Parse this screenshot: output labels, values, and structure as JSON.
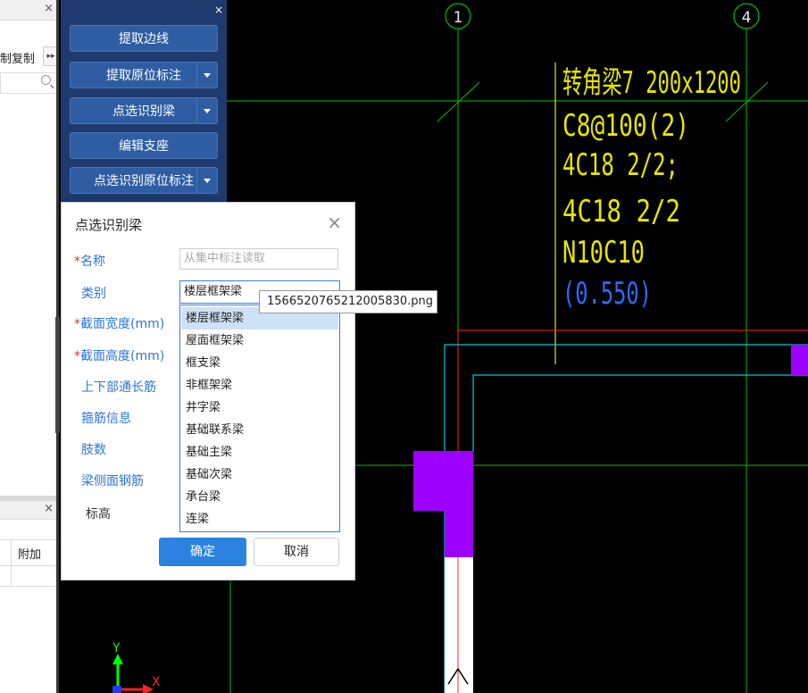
{
  "left_panel": {
    "copy_label": "制复制",
    "copy_more_icon": "double-chevron-right-icon",
    "search_icon": "search-icon",
    "close_icon": "close-icon",
    "grid_header": "附加"
  },
  "toolbar": {
    "close": "×",
    "buttons": [
      {
        "label": "提取边线",
        "has_menu": false
      },
      {
        "label": "提取原位标注",
        "has_menu": true
      },
      {
        "label": "点选识别梁",
        "has_menu": true
      },
      {
        "label": "编辑支座",
        "has_menu": false
      },
      {
        "label": "点选识别原位标注",
        "has_menu": true
      }
    ]
  },
  "cad": {
    "axis_left": "1",
    "axis_right": "4",
    "annotation": {
      "line1": "转角梁7 200x1200",
      "line2": "C8@100(2)",
      "line3": "4C18 2/2;",
      "line4": "4C18 2/2",
      "line5": "N10C10",
      "line6": "(0.550)"
    },
    "ucs_y": "Y",
    "ucs_x": "X",
    "colors": {
      "yellow": "#e6e600",
      "green": "#00c000",
      "red": "#ff2020",
      "cyan": "#00c8d8",
      "magenta": "#9d00ff",
      "blue_text": "#2b6bff"
    }
  },
  "dialog": {
    "title": "点选识别梁",
    "close": "×",
    "fields": {
      "name": "名称",
      "type": "类别",
      "width": "截面宽度(mm)",
      "height": "截面高度(mm)",
      "long_bars": "上下部通长筋",
      "stirrup": "箍筋信息",
      "legs": "肢数",
      "side_bars": "梁侧面钢筋",
      "elevation": "标高"
    },
    "name_placeholder": "从集中标注读取",
    "type_value": "楼层框架梁",
    "options": [
      "楼层框架梁",
      "屋面框架梁",
      "框支梁",
      "非框架梁",
      "井字梁",
      "基础联系梁",
      "基础主梁",
      "基础次梁",
      "承台梁",
      "连梁"
    ],
    "ok": "确定",
    "cancel": "取消"
  },
  "tooltip": "1566520765212005830.png"
}
